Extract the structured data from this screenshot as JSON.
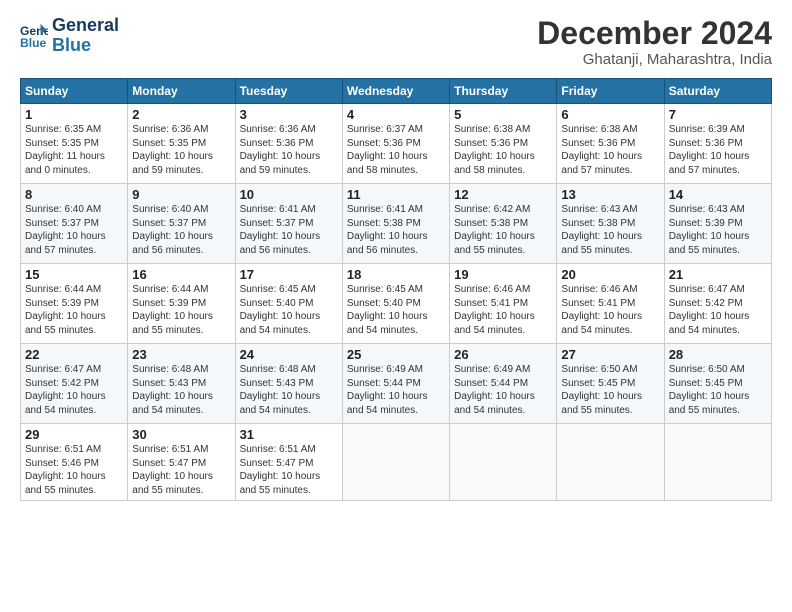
{
  "header": {
    "logo_line1": "General",
    "logo_line2": "Blue",
    "month": "December 2024",
    "location": "Ghatanji, Maharashtra, India"
  },
  "weekdays": [
    "Sunday",
    "Monday",
    "Tuesday",
    "Wednesday",
    "Thursday",
    "Friday",
    "Saturday"
  ],
  "weeks": [
    [
      {
        "day": "1",
        "sunrise": "6:35 AM",
        "sunset": "5:35 PM",
        "daylight": "11 hours and 0 minutes."
      },
      {
        "day": "2",
        "sunrise": "6:36 AM",
        "sunset": "5:35 PM",
        "daylight": "10 hours and 59 minutes."
      },
      {
        "day": "3",
        "sunrise": "6:36 AM",
        "sunset": "5:36 PM",
        "daylight": "10 hours and 59 minutes."
      },
      {
        "day": "4",
        "sunrise": "6:37 AM",
        "sunset": "5:36 PM",
        "daylight": "10 hours and 58 minutes."
      },
      {
        "day": "5",
        "sunrise": "6:38 AM",
        "sunset": "5:36 PM",
        "daylight": "10 hours and 58 minutes."
      },
      {
        "day": "6",
        "sunrise": "6:38 AM",
        "sunset": "5:36 PM",
        "daylight": "10 hours and 57 minutes."
      },
      {
        "day": "7",
        "sunrise": "6:39 AM",
        "sunset": "5:36 PM",
        "daylight": "10 hours and 57 minutes."
      }
    ],
    [
      {
        "day": "8",
        "sunrise": "6:40 AM",
        "sunset": "5:37 PM",
        "daylight": "10 hours and 57 minutes."
      },
      {
        "day": "9",
        "sunrise": "6:40 AM",
        "sunset": "5:37 PM",
        "daylight": "10 hours and 56 minutes."
      },
      {
        "day": "10",
        "sunrise": "6:41 AM",
        "sunset": "5:37 PM",
        "daylight": "10 hours and 56 minutes."
      },
      {
        "day": "11",
        "sunrise": "6:41 AM",
        "sunset": "5:38 PM",
        "daylight": "10 hours and 56 minutes."
      },
      {
        "day": "12",
        "sunrise": "6:42 AM",
        "sunset": "5:38 PM",
        "daylight": "10 hours and 55 minutes."
      },
      {
        "day": "13",
        "sunrise": "6:43 AM",
        "sunset": "5:38 PM",
        "daylight": "10 hours and 55 minutes."
      },
      {
        "day": "14",
        "sunrise": "6:43 AM",
        "sunset": "5:39 PM",
        "daylight": "10 hours and 55 minutes."
      }
    ],
    [
      {
        "day": "15",
        "sunrise": "6:44 AM",
        "sunset": "5:39 PM",
        "daylight": "10 hours and 55 minutes."
      },
      {
        "day": "16",
        "sunrise": "6:44 AM",
        "sunset": "5:39 PM",
        "daylight": "10 hours and 55 minutes."
      },
      {
        "day": "17",
        "sunrise": "6:45 AM",
        "sunset": "5:40 PM",
        "daylight": "10 hours and 54 minutes."
      },
      {
        "day": "18",
        "sunrise": "6:45 AM",
        "sunset": "5:40 PM",
        "daylight": "10 hours and 54 minutes."
      },
      {
        "day": "19",
        "sunrise": "6:46 AM",
        "sunset": "5:41 PM",
        "daylight": "10 hours and 54 minutes."
      },
      {
        "day": "20",
        "sunrise": "6:46 AM",
        "sunset": "5:41 PM",
        "daylight": "10 hours and 54 minutes."
      },
      {
        "day": "21",
        "sunrise": "6:47 AM",
        "sunset": "5:42 PM",
        "daylight": "10 hours and 54 minutes."
      }
    ],
    [
      {
        "day": "22",
        "sunrise": "6:47 AM",
        "sunset": "5:42 PM",
        "daylight": "10 hours and 54 minutes."
      },
      {
        "day": "23",
        "sunrise": "6:48 AM",
        "sunset": "5:43 PM",
        "daylight": "10 hours and 54 minutes."
      },
      {
        "day": "24",
        "sunrise": "6:48 AM",
        "sunset": "5:43 PM",
        "daylight": "10 hours and 54 minutes."
      },
      {
        "day": "25",
        "sunrise": "6:49 AM",
        "sunset": "5:44 PM",
        "daylight": "10 hours and 54 minutes."
      },
      {
        "day": "26",
        "sunrise": "6:49 AM",
        "sunset": "5:44 PM",
        "daylight": "10 hours and 54 minutes."
      },
      {
        "day": "27",
        "sunrise": "6:50 AM",
        "sunset": "5:45 PM",
        "daylight": "10 hours and 55 minutes."
      },
      {
        "day": "28",
        "sunrise": "6:50 AM",
        "sunset": "5:45 PM",
        "daylight": "10 hours and 55 minutes."
      }
    ],
    [
      {
        "day": "29",
        "sunrise": "6:51 AM",
        "sunset": "5:46 PM",
        "daylight": "10 hours and 55 minutes."
      },
      {
        "day": "30",
        "sunrise": "6:51 AM",
        "sunset": "5:47 PM",
        "daylight": "10 hours and 55 minutes."
      },
      {
        "day": "31",
        "sunrise": "6:51 AM",
        "sunset": "5:47 PM",
        "daylight": "10 hours and 55 minutes."
      },
      null,
      null,
      null,
      null
    ]
  ]
}
